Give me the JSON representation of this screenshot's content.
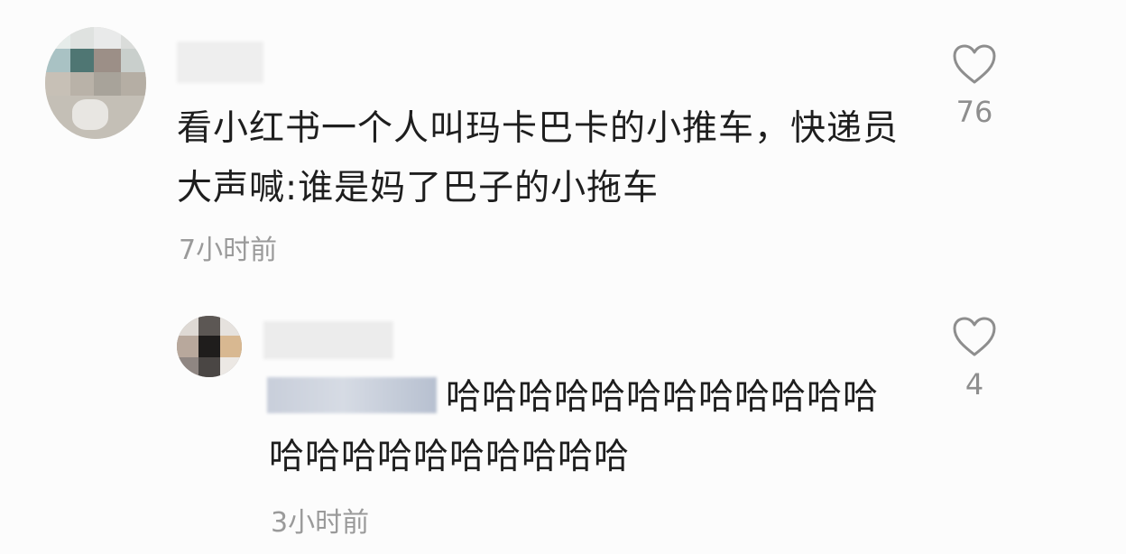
{
  "comments": [
    {
      "text": "看小红书一个人叫玛卡巴卡的小推车，快递员大声喊:谁是妈了巴子的小拖车",
      "time": "7小时前",
      "likes": "76"
    },
    {
      "text": "哈哈哈哈哈哈哈哈哈哈哈哈哈哈哈哈哈哈哈哈哈哈",
      "time": "3小时前",
      "likes": "4"
    }
  ],
  "icons": {
    "like": "heart-outline-icon"
  },
  "colors": {
    "text": "#1e1e1e",
    "muted": "#9a9a9a",
    "background": "#fcfcfc"
  }
}
